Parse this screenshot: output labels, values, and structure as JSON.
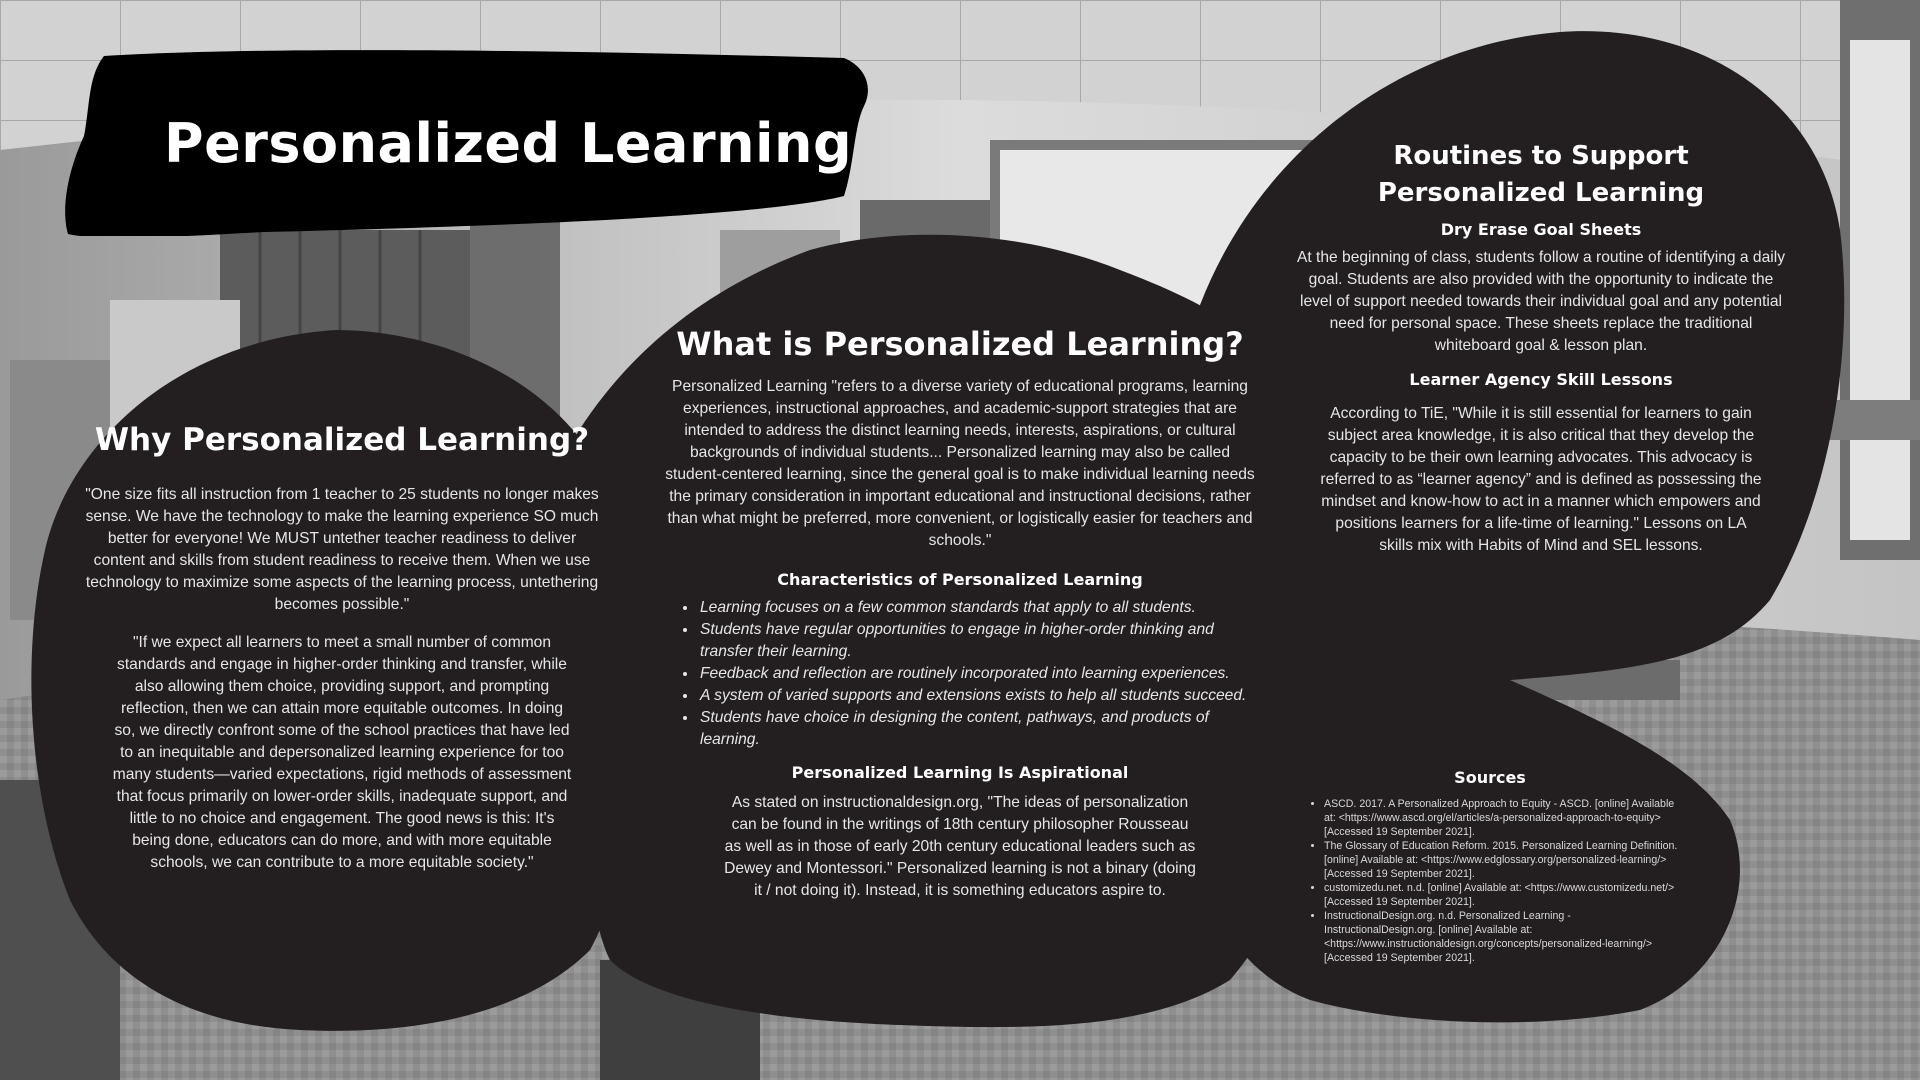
{
  "title": "Personalized Learning",
  "why": {
    "heading": "Why Personalized Learning?",
    "quote1": "\"One size fits all instruction from 1 teacher to 25 students no longer makes sense. We have the technology to make the learning experience SO much better for everyone! We MUST untether teacher readiness to deliver content and skills from student readiness to receive them. When we use technology to maximize some aspects of the learning process, untethering becomes possible.\"",
    "quote2": "\"If we expect all learners to meet a small number of common standards and engage in higher-order thinking and transfer, while also allowing them choice, providing support, and prompting reflection, then we can attain more equitable outcomes. In doing so, we directly confront some of the school practices that have led to an inequitable and depersonalized learning experience for too many students—varied expectations, rigid methods of assessment that focus primarily on lower-order skills, inadequate support, and little to no choice and engagement. The good news is this: It's being done, educators can do more, and with more equitable schools, we can contribute to a more equitable society.\""
  },
  "what": {
    "heading": "What is Personalized Learning?",
    "definition": "Personalized Learning \"refers to a diverse variety of educational programs, learning experiences, instructional approaches, and academic-support strategies that are intended to address the distinct learning needs, interests, aspirations, or cultural backgrounds of individual students... Personalized learning may also be called student-centered learning, since the general goal is to make individual learning needs the primary consideration in important educational and instructional decisions, rather than what might be preferred, more convenient, or logistically easier for teachers and schools.\"",
    "characteristics_heading": "Characteristics of Personalized Learning",
    "characteristics": [
      "Learning focuses on a few common standards that apply to all students.",
      "Students have regular opportunities to engage in higher-order thinking and transfer their learning.",
      "Feedback and reflection are routinely incorporated into learning experiences.",
      "A system of varied supports and extensions exists to help all students succeed.",
      "Students have choice in designing the content, pathways, and products of learning."
    ],
    "aspirational_heading": "Personalized Learning Is Aspirational",
    "aspirational": "As stated on instructionaldesign.org, \"The ideas of personalization can be found in the writings of 18th century philosopher Rousseau as well as in those of early 20th century educational leaders such as Dewey and Montessori.\" Personalized learning is not a binary (doing it / not doing it). Instead, it is something educators aspire to."
  },
  "routines": {
    "heading": "Routines to Support Personalized Learning",
    "sub1": "Dry Erase Goal Sheets",
    "text1": "At the beginning of class, students follow a routine of identifying a daily goal. Students are also provided with the opportunity to indicate the level of support needed towards their individual goal and any potential need for personal space. These sheets replace the traditional whiteboard goal & lesson plan.",
    "sub2": "Learner Agency Skill Lessons",
    "text2": "According to TiE, \"While it is still essential for learners to gain subject area knowledge, it is also critical that they develop the capacity to be their own learning advocates. This advocacy is referred to as “learner agency” and is defined as possessing the mindset and know-how to act in a manner which empowers and positions learners for a life-time of learning.\" Lessons on LA skills mix with Habits of Mind and SEL lessons."
  },
  "sources": {
    "heading": "Sources",
    "items": [
      "ASCD. 2017. A Personalized Approach to Equity - ASCD. [online] Available at: <https://www.ascd.org/el/articles/a-personalized-approach-to-equity> [Accessed 19 September 2021].",
      "The Glossary of Education Reform. 2015. Personalized Learning Definition. [online] Available at: <https://www.edglossary.org/personalized-learning/> [Accessed 19 September 2021].",
      "customizedu.net. n.d. [online] Available at: <https://www.customizedu.net/> [Accessed 19 September 2021].",
      "InstructionalDesign.org. n.d. Personalized Learning - InstructionalDesign.org. [online] Available at: <https://www.instructionaldesign.org/concepts/personalized-learning/> [Accessed 19 September 2021]."
    ]
  },
  "colors": {
    "panel": "#231f20",
    "banner": "#000000",
    "heading_text": "#ffffff",
    "body_text": "#e6e6e6"
  }
}
